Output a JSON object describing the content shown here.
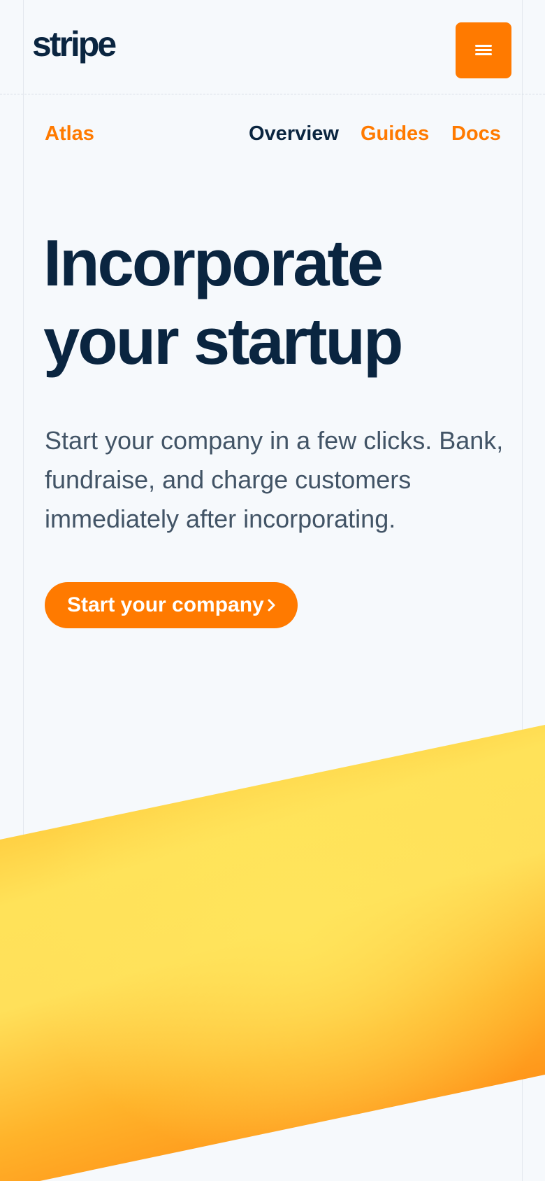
{
  "header": {
    "logo_text": "stripe",
    "menu_icon": "hamburger-menu-icon"
  },
  "subnav": {
    "brand": "Atlas",
    "links": [
      "Overview",
      "Guides",
      "Docs"
    ],
    "active": "Overview"
  },
  "hero": {
    "title_line1": "Incorporate",
    "title_line2": "your startup",
    "subtitle": "Start your company in a few clicks. Bank, fundraise, and charge customers immediately after incorporating.",
    "cta_label": "Start your company",
    "cta_icon": "chevron-right-icon"
  },
  "colors": {
    "accent": "#ff7a00",
    "heading": "#0a2540",
    "body_text": "#425466",
    "background": "#f6f9fc",
    "band_light": "#ffe259",
    "band_dark": "#ff9a1a"
  }
}
